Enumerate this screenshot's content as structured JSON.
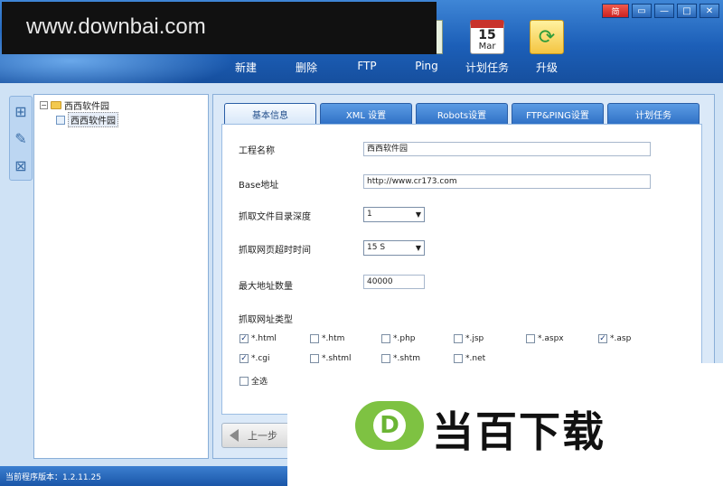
{
  "watermark": {
    "text": "www.downbai.com"
  },
  "toolbar": [
    {
      "label": "新建",
      "icon": "new-icon"
    },
    {
      "label": "删除",
      "icon": "delete-icon"
    },
    {
      "label": "FTP",
      "icon": "ftp-icon"
    },
    {
      "label": "Ping",
      "icon": "ping-icon"
    },
    {
      "label": "计划任务",
      "icon": "calendar-icon",
      "cal_day": "15",
      "cal_month": "Mar"
    },
    {
      "label": "升级",
      "icon": "upgrade-icon"
    }
  ],
  "window_controls": {
    "lang": "简"
  },
  "tree": {
    "root": "西西软件园",
    "child": "西西软件园"
  },
  "tabs": [
    {
      "label": "基本信息",
      "active": true
    },
    {
      "label": "XML 设置",
      "active": false
    },
    {
      "label": "Robots设置",
      "active": false
    },
    {
      "label": "FTP&PING设置",
      "active": false
    },
    {
      "label": "计划任务",
      "active": false
    }
  ],
  "form": {
    "project_name_label": "工程名称",
    "project_name_value": "西西软件园",
    "base_url_label": "Base地址",
    "base_url_value": "http://www.cr173.com",
    "depth_label": "抓取文件目录深度",
    "depth_value": "1",
    "timeout_label": "抓取网页超时时间",
    "timeout_value": "15 S",
    "max_urls_label": "最大地址数量",
    "max_urls_value": "40000",
    "types_label": "抓取网址类型"
  },
  "file_types": [
    {
      "label": "*.html",
      "checked": true
    },
    {
      "label": "*.htm",
      "checked": false
    },
    {
      "label": "*.php",
      "checked": false
    },
    {
      "label": "*.jsp",
      "checked": false
    },
    {
      "label": "*.aspx",
      "checked": false
    },
    {
      "label": "*.asp",
      "checked": true
    },
    {
      "label": "*.cgi",
      "checked": true
    },
    {
      "label": "*.shtml",
      "checked": false
    },
    {
      "label": "*.shtm",
      "checked": false
    },
    {
      "label": "*.net",
      "checked": false
    }
  ],
  "select_all": {
    "label": "全选",
    "checked": false
  },
  "nav": {
    "prev_label": "上一步"
  },
  "status": {
    "text": "当前程序版本：1.2.11.25"
  },
  "brand": {
    "logo_letter": "D",
    "text": "当百下载"
  },
  "colors": {
    "header_blue": "#1c5fb8",
    "accent_green": "#7ec242",
    "tab_blue": "#2e6fc5"
  }
}
